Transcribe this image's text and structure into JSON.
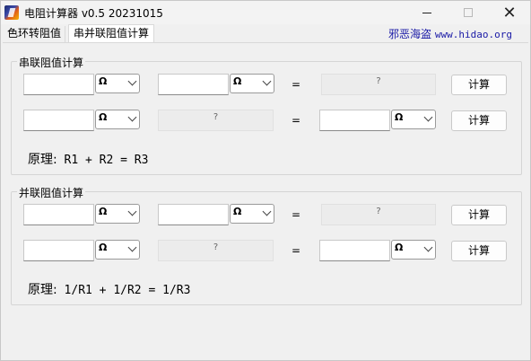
{
  "window": {
    "title": "电阻计算器 v0.5 20231015",
    "minimize_label": "—",
    "close_label": "✕"
  },
  "tabs": [
    {
      "label": "色环转阻值"
    },
    {
      "label": "串并联阻值计算"
    }
  ],
  "site": {
    "name": "邪恶海盗",
    "url": "www.hidao.org"
  },
  "series": {
    "group_label": "串联阻值计算",
    "row1": {
      "r1_value": "",
      "r1_unit": "Ω",
      "r2_value": "",
      "r2_unit": "Ω",
      "equals": "=",
      "result": "?",
      "calc_label": "计算"
    },
    "row2": {
      "r1_value": "",
      "r1_unit": "Ω",
      "result": "?",
      "equals": "=",
      "r3_value": "",
      "r3_unit": "Ω",
      "calc_label": "计算"
    },
    "principle_prefix": "原理:",
    "principle_formula": " R1 + R2 = R3"
  },
  "parallel": {
    "group_label": "并联阻值计算",
    "row1": {
      "r1_value": "",
      "r1_unit": "Ω",
      "r2_value": "",
      "r2_unit": "Ω",
      "equals": "=",
      "result": "?",
      "calc_label": "计算"
    },
    "row2": {
      "r1_value": "",
      "r1_unit": "Ω",
      "result": "?",
      "equals": "=",
      "r3_value": "",
      "r3_unit": "Ω",
      "calc_label": "计算"
    },
    "principle_prefix": "原理:",
    "principle_formula": " 1/R1 + 1/R2 = 1/R3"
  }
}
